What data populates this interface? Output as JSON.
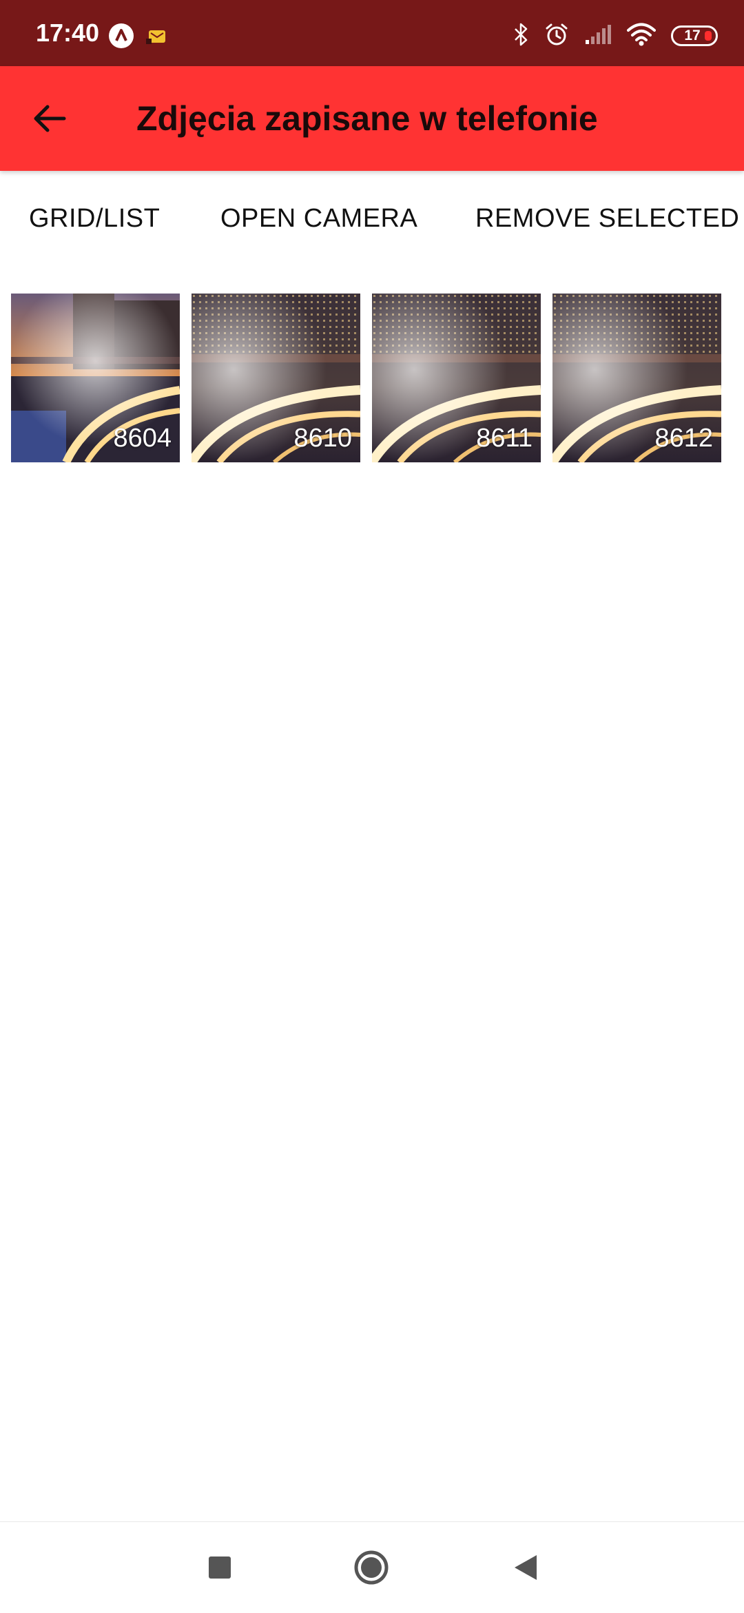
{
  "status_bar": {
    "time": "17:40",
    "battery_level": "17",
    "icons": [
      "app-notification-icon",
      "message-icon",
      "bluetooth-icon",
      "alarm-icon",
      "cell-signal-icon",
      "wifi-icon",
      "battery-icon"
    ]
  },
  "app_bar": {
    "title": "Zdjęcia zapisane w telefonie",
    "back_icon": "arrow-left-icon"
  },
  "toolbar": {
    "grid_list_label": "GRID/LIST",
    "open_camera_label": "OPEN CAMERA",
    "remove_selected_label": "REMOVE SELECTED"
  },
  "photos": [
    {
      "label": "8604"
    },
    {
      "label": "8610"
    },
    {
      "label": "8611"
    },
    {
      "label": "8612"
    }
  ],
  "nav_bar": {
    "icons": [
      "recents-icon",
      "home-icon",
      "back-icon"
    ]
  },
  "colors": {
    "status_bar": "#771818",
    "app_bar": "#ff3333",
    "title_text": "#1a0a0a",
    "background": "#ffffff",
    "nav_icon": "#555555"
  }
}
